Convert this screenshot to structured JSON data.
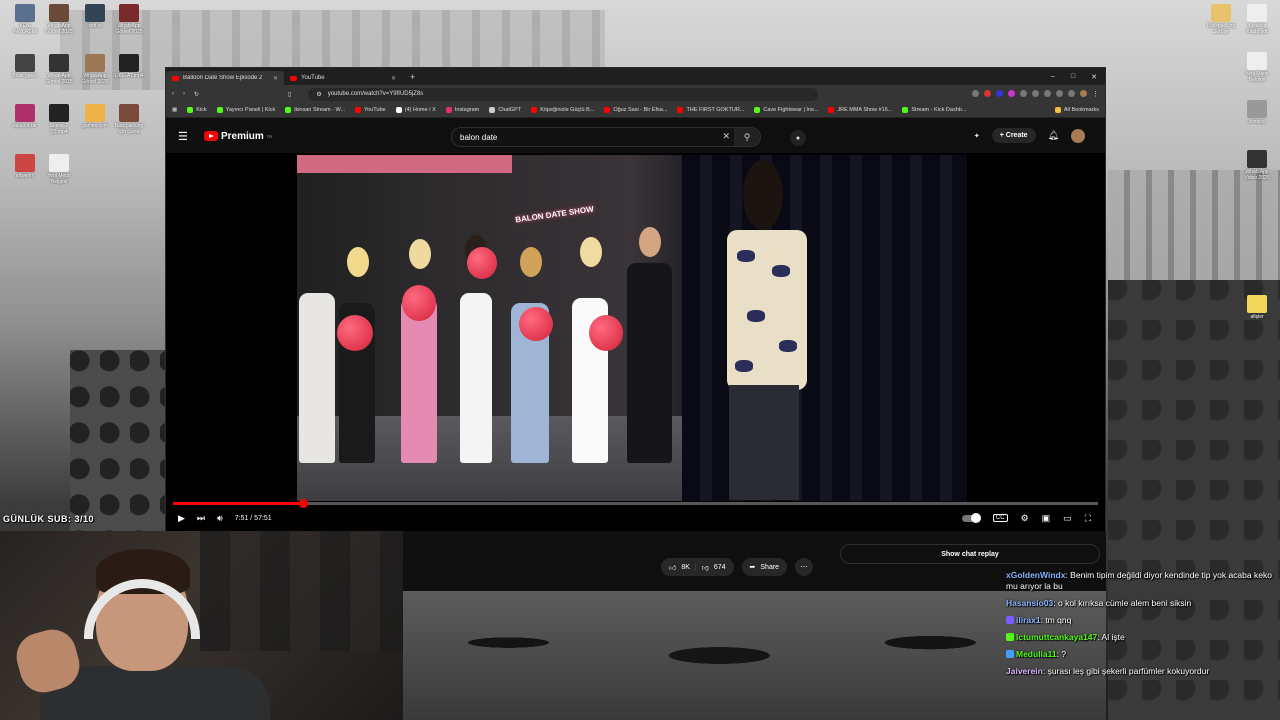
{
  "desktop": {
    "left_icons": [
      {
        "label": "YENİ PAYLAŞIM",
        "color": "#5b6f91"
      },
      {
        "label": "WhatsApp Görsel 2025",
        "color": "#6b4a3a"
      },
      {
        "label": "sett.ei",
        "color": "#334455"
      },
      {
        "label": "WhatsApp Görsel 2025",
        "color": "#7a2a2a"
      },
      {
        "label": "Birak gecer",
        "color": "#444"
      },
      {
        "label": "WhatsApp Görsel 2025",
        "color": "#333"
      },
      {
        "label": "WhatsApp Görsel 2025",
        "color": "#9b7755"
      },
      {
        "label": "LIKE-AT.mp4",
        "color": "#222"
      },
      {
        "label": "takeout.rar",
        "color": "#b0306a"
      },
      {
        "label": "Scene-1 (3).mp4",
        "color": "#222"
      },
      {
        "label": "games.com",
        "color": "#f0b34a"
      },
      {
        "label": "Backpacking için çanta",
        "color": "#7a4a3a"
      },
      {
        "label": "afişlerim",
        "color": "#c44"
      },
      {
        "label": "Yeni Metin Belgesi",
        "color": "#eee"
      }
    ],
    "right_icons": [
      {
        "label": "Backpacking Sürüşe",
        "color": "#e8c36b"
      },
      {
        "label": "Yasaklar Kitabı.pdf",
        "color": "#eee"
      },
      {
        "label": "Yeni Metin Belgesi",
        "color": "#eee"
      },
      {
        "label": "ilonlpsy",
        "color": "#999"
      },
      {
        "label": "WhatsApp Video 2025",
        "color": "#333"
      },
      {
        "label": "afişler",
        "color": "#f0d75a"
      }
    ]
  },
  "browser": {
    "tabs": [
      {
        "title": "Balloon Date Show Episode 2",
        "active": true
      },
      {
        "title": "YouTube",
        "active": false
      }
    ],
    "new_tab": "+",
    "window_controls": [
      "–",
      "□",
      "✕"
    ],
    "url": "youtube.com/watch?v=Y9fIUD5jZ8s",
    "bookmarks": [
      {
        "label": "Kick",
        "color": "#53fc18"
      },
      {
        "label": "Yayıncı Paneli | Kick",
        "color": "#53fc18"
      },
      {
        "label": "ikinsan Stream - W...",
        "color": "#53fc18"
      },
      {
        "label": "YouTube",
        "color": "#ff0000"
      },
      {
        "label": "(4) Home / X",
        "color": "#ffffff"
      },
      {
        "label": "Instagram",
        "color": "#e1306c"
      },
      {
        "label": "ChatGPT",
        "color": "#cccccc"
      },
      {
        "label": "Köpeğinizle Güçlü B...",
        "color": "#ff0000"
      },
      {
        "label": "Oğuz Sasi - Bir Efsa...",
        "color": "#ff0000"
      },
      {
        "label": "THE FIRST GOKTUR...",
        "color": "#ff0000"
      },
      {
        "label": "Cave Fightwear | Ins...",
        "color": "#53fc18"
      },
      {
        "label": "JRE MMA Show #16...",
        "color": "#ff0000"
      },
      {
        "label": "Stream - Kick Dashb...",
        "color": "#53fc18"
      }
    ],
    "all_bookmarks": "All Bookmarks"
  },
  "youtube": {
    "logo_text": "Premium",
    "logo_sup": "TR",
    "search_value": "balon date",
    "create_label": "Create",
    "video": {
      "neon_sign": "BALON DATE SHOW",
      "current_time": "7:51",
      "duration": "57:51",
      "progress_fraction": 0.14
    },
    "actions": {
      "likes": "8K",
      "dislikes": "674",
      "share": "Share"
    },
    "show_chat_replay": "Show chat replay"
  },
  "overlay": {
    "gunluk_sub": "GÜNLÜK SUB: 3/10"
  },
  "chat": [
    {
      "user": "xGoldenWindx",
      "text": "Benim tipim değildi diyor kendinde tip yok acaba keko mu arıyor la bu",
      "color": "#8ab4ff",
      "badge": ""
    },
    {
      "user": "Hasansio03",
      "text": "o kol kırıksa cümle alem beni siksin",
      "color": "#8ab4ff",
      "badge": ""
    },
    {
      "user": "ilirax1",
      "text": "tm qnq",
      "color": "#8ab4ff",
      "badge": "#7a5cff"
    },
    {
      "user": "lctumuttcankaya147",
      "text": "Al işte",
      "color": "#53fc18",
      "badge": "#53fc18"
    },
    {
      "user": "Medulla11",
      "text": "?",
      "color": "#53fc18",
      "badge": "#3fa0ff"
    },
    {
      "user": "Jaiverein",
      "text": "şurası leş gibi şekerli parfümler kokuyordur",
      "color": "#d8b4ff",
      "badge": ""
    }
  ]
}
